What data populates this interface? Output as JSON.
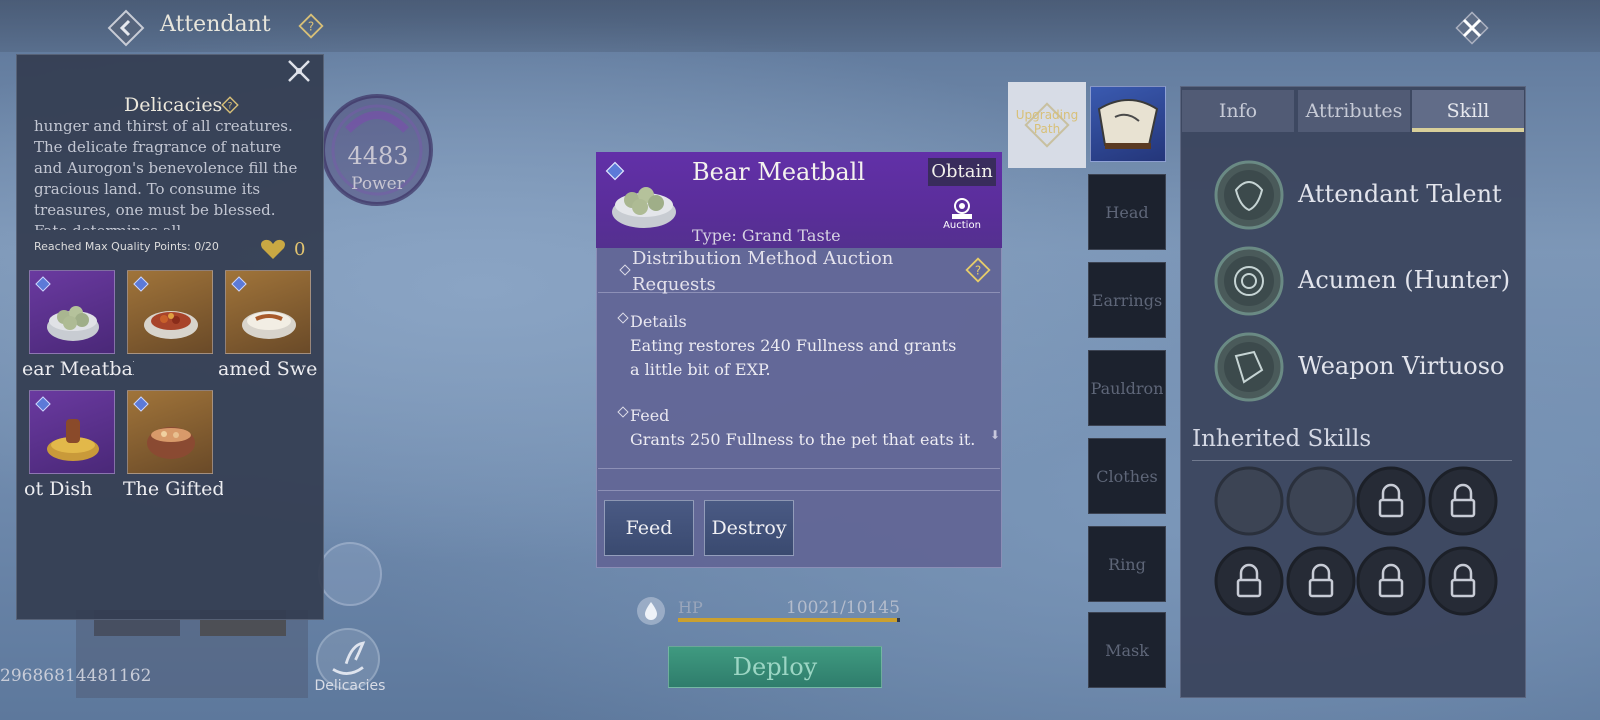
{
  "header": {
    "title": "Attendant"
  },
  "background": {
    "power_value": "4483",
    "power_label": "Power",
    "delicacies_nav_label": "Delicacies",
    "player_id": "29686814481162"
  },
  "left_panel": {
    "title": "Delicacies",
    "description": "hunger and thirst of all creatures. The delicate fragrance of nature and Aurogon's benevolence fill the gracious land. To consume its treasures, one must be blessed. Fate determines all",
    "quality_points": "Reached Max Quality Points: 0/20",
    "heart_count": "0",
    "items": [
      {
        "label": "ear Meatbal",
        "rarity": "purple",
        "icon": "meatball-bowl-icon"
      },
      {
        "label": "",
        "rarity": "gold",
        "icon": "stir-fry-dish-icon"
      },
      {
        "label": "amed Sweet",
        "rarity": "gold",
        "icon": "rice-dish-icon"
      },
      {
        "label": "ot Dish",
        "rarity": "purple",
        "icon": "hot-pot-icon"
      },
      {
        "label": "The Gifted",
        "rarity": "gold",
        "icon": "clay-pot-icon"
      }
    ]
  },
  "card": {
    "name": "Bear Meatball",
    "obtain_label": "Obtain",
    "auction_label": "Auction",
    "type_text": "Type: Grand Taste",
    "distribution_text": "Distribution Method    Auction Requests",
    "details_title": "Details",
    "details_text": "Eating restores 240 Fullness and grants a little bit of EXP.",
    "feed_title": "Feed",
    "feed_text": "Grants 250 Fullness to the pet that eats it.",
    "feed_button": "Feed",
    "destroy_button": "Destroy"
  },
  "status": {
    "hp_label": "HP",
    "hp_value": "10021/10145",
    "hp_fraction": 0.988,
    "deploy_label": "Deploy"
  },
  "equipment": {
    "upgrade_label": "Upgrading Path",
    "slots": [
      "Head",
      "Earrings",
      "Pauldron",
      "Clothes",
      "Ring",
      "Mask"
    ]
  },
  "right_panel": {
    "tabs": [
      "Info",
      "Attributes",
      "Skill"
    ],
    "active_tab": "Skill",
    "skills": [
      {
        "name": "Attendant Talent",
        "icon": "talent-icon"
      },
      {
        "name": "Acumen (Hunter)",
        "icon": "acumen-icon"
      },
      {
        "name": "Weapon Virtuoso",
        "icon": "weapon-virtuoso-icon"
      }
    ],
    "inherited_title": "Inherited Skills",
    "inherited_slots": [
      "empty",
      "empty",
      "locked",
      "locked",
      "locked",
      "locked",
      "locked",
      "locked"
    ]
  },
  "colors": {
    "accent_gold": "#d8cf9a",
    "rarity_purple": "#6230a8",
    "deploy_green": "#3f9a80",
    "hp_yellow": "#caa030"
  }
}
